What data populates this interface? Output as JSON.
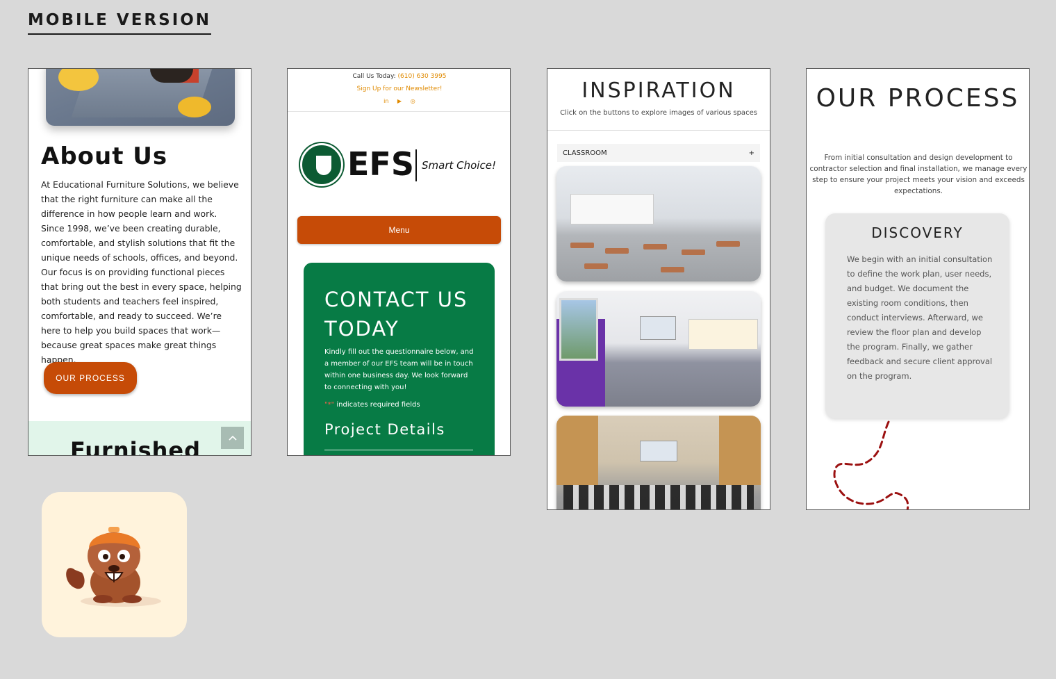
{
  "page": {
    "heading": "MOBILE VERSION"
  },
  "about": {
    "title": "About Us",
    "body": "At Educational Furniture Solutions, we believe that the right furniture can make all the difference in how people learn and work. Since 1998, we’ve been creating durable, comfortable, and stylish solutions that fit the unique needs of schools, offices, and beyond. Our focus is on providing functional pieces that bring out the best in every space, helping both students and teachers feel inspired, comfortable, and ready to succeed. We’re here to help you build spaces that work—because great spaces make great things happen.",
    "button": "OUR PROCESS",
    "next_section": "Furnished",
    "back_to_top_icon": "chevron-up-icon"
  },
  "contact": {
    "call_label": "Call Us Today:",
    "phone": "(610) 630 3995",
    "newsletter": "Sign Up for our Newsletter!",
    "socials": [
      "in",
      "▶",
      "◎"
    ],
    "logo_text": "EFS",
    "tagline": "Smart Choice!",
    "menu_button": "Menu",
    "title": "CONTACT US TODAY",
    "body": "Kindly fill out the questionnaire below, and a member of our EFS team will be in touch within one business day. We look forward to connecting with you!",
    "required_mark": "\"*\"",
    "required_text": " indicates required fields",
    "section": "Project Details",
    "colors": {
      "accent": "#c64b07",
      "green": "#077b45"
    }
  },
  "inspiration": {
    "title": "INSPIRATION",
    "subtitle": "Click on the buttons to explore images of various spaces",
    "accordion_label": "CLASSROOM",
    "accordion_icon": "+"
  },
  "process": {
    "title": "OUR PROCESS",
    "body": "From initial consultation and design development to contractor selection and final installation, we manage every step to ensure your project meets your vision and exceeds expectations.",
    "card_title": "DISCOVERY",
    "card_body": "We begin with an initial consultation to define the work plan, user needs, and budget. We document the existing room conditions, then conduct interviews. Afterward, we review the floor plan and develop the program. Finally, we gather feedback and secure client approval on the program."
  }
}
